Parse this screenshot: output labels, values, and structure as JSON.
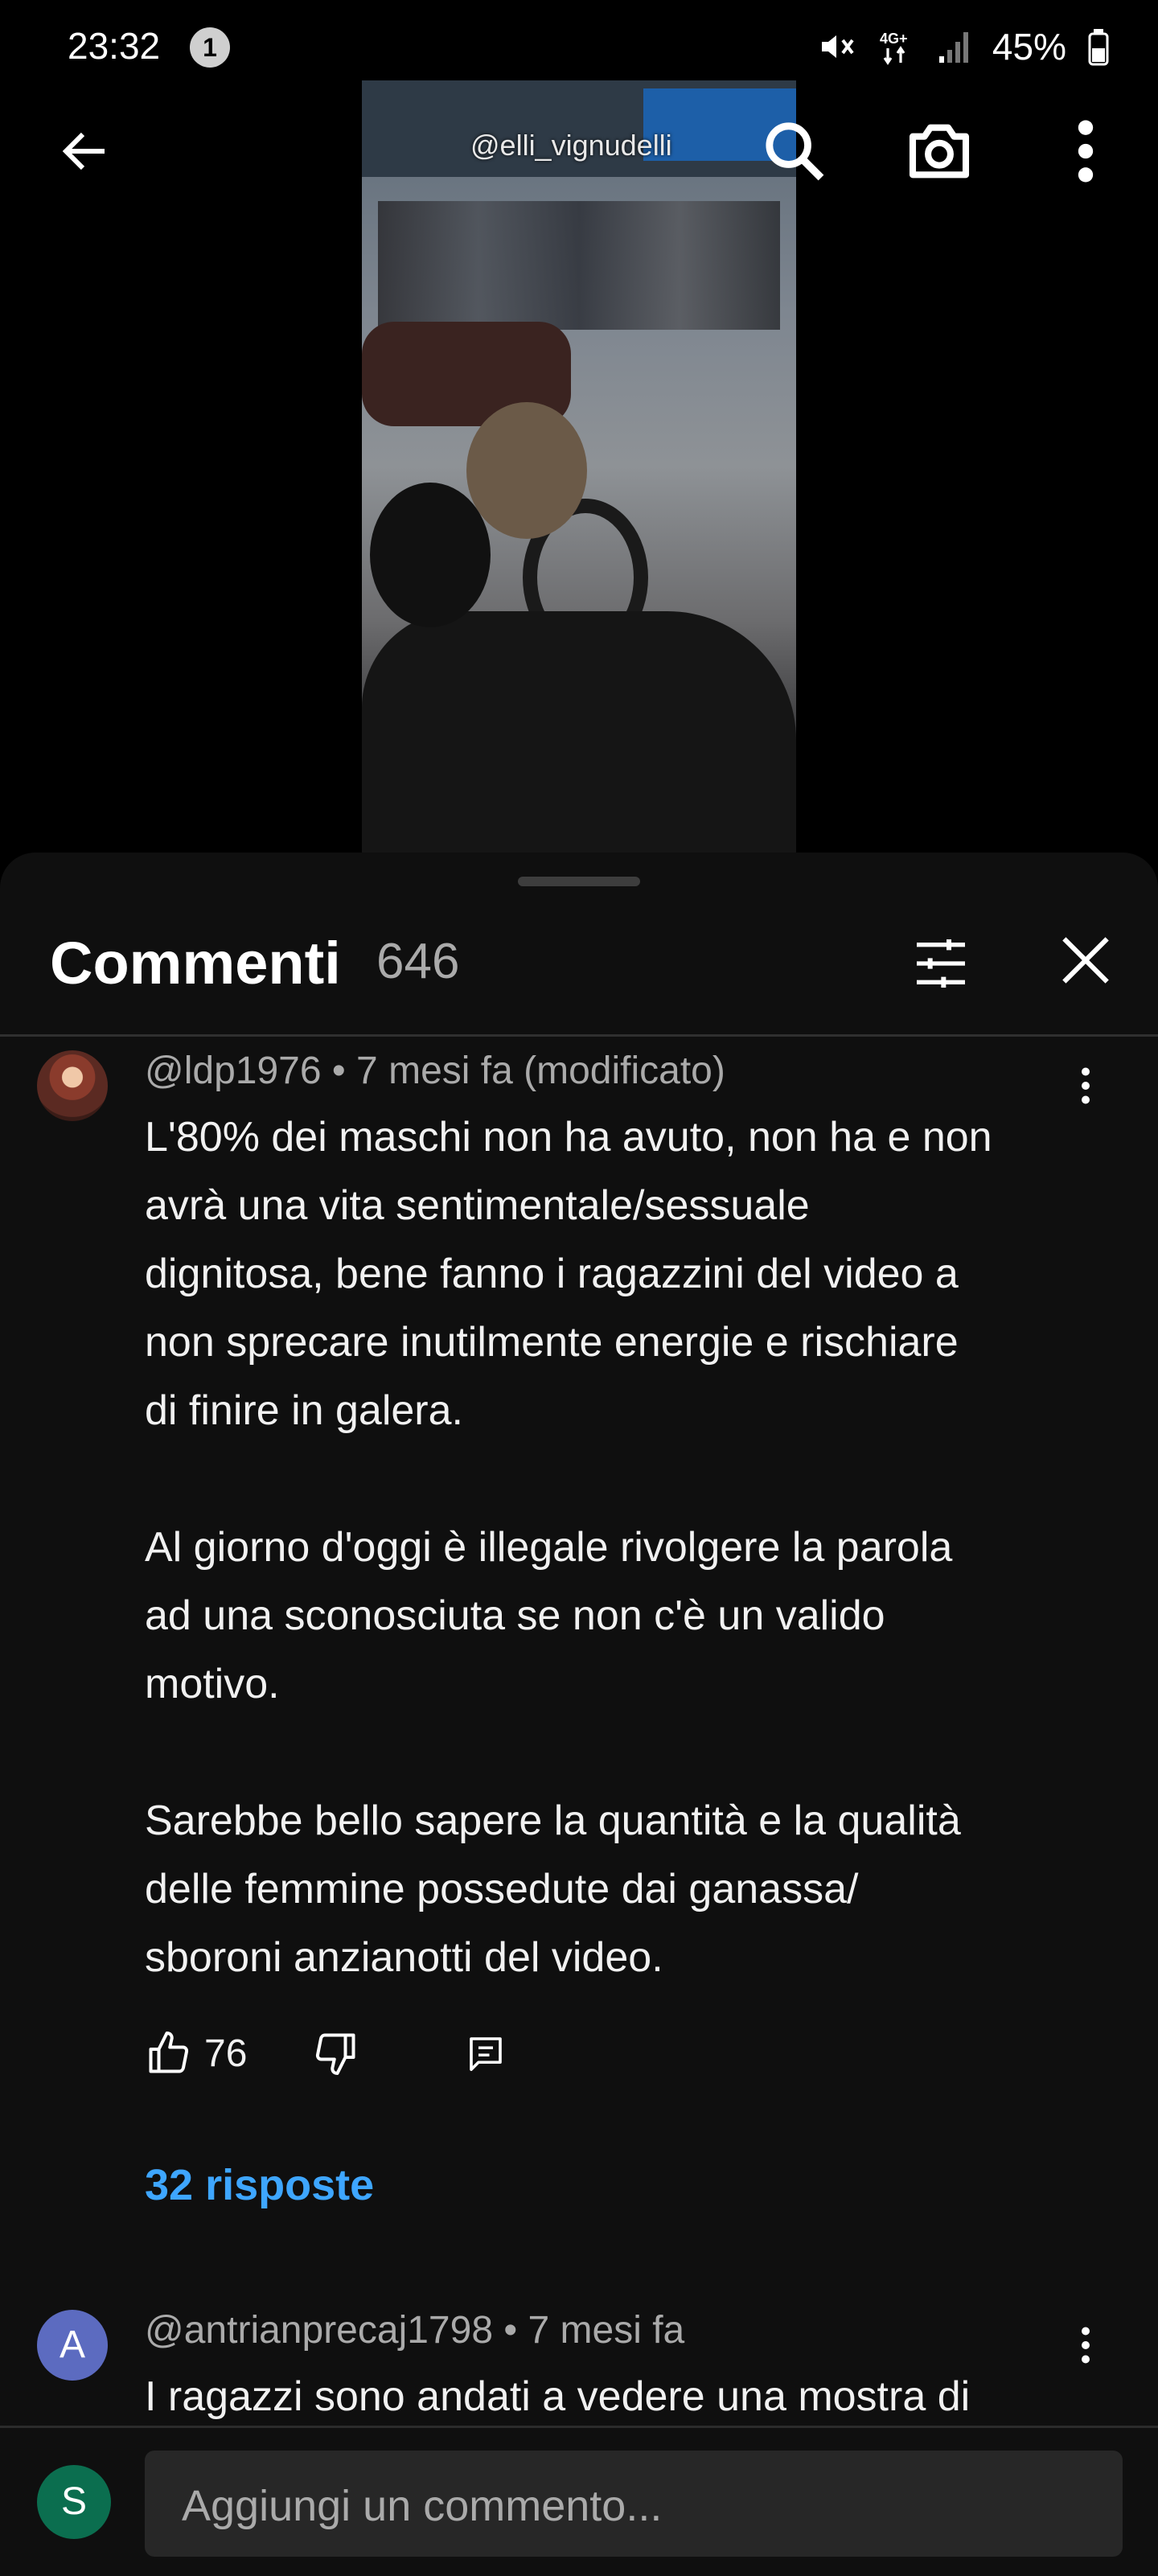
{
  "status_bar": {
    "time": "23:32",
    "notification_count": "1",
    "network": "4G+",
    "battery": "45%"
  },
  "video": {
    "watermark": "@elli_vignudelli"
  },
  "comments_sheet": {
    "title": "Commenti",
    "count": "646",
    "comments": [
      {
        "author": "@ldp1976",
        "time": "7 mesi fa (modificato)",
        "text": "L'80% dei maschi non ha avuto, non ha e non\navrà una vita sentimentale/sessuale\ndignitosa, bene fanno i ragazzini del video a\nnon sprecare inutilmente energie e rischiare\ndi finire in galera.\n\nAl giorno d'oggi è illegale rivolgere la parola\nad una sconosciuta se non c'è un valido\nmotivo.\n\nSarebbe bello sapere la quantità e la qualità\ndelle femmine possedute dai ganassa/\nsboroni anzianotti del video.",
        "likes": "76",
        "replies": "32 risposte"
      },
      {
        "author": "@antrianprecaj1798",
        "time": "7 mesi fa",
        "avatar_letter": "A",
        "text": "I ragazzi sono andati a vedere una mostra di"
      }
    ]
  },
  "comment_input": {
    "user_initial": "S",
    "placeholder": "Aggiungi un commento..."
  },
  "colors": {
    "sheet_bg": "#0f0f0f",
    "link": "#3ea6ff",
    "meta": "#aaaaaa"
  }
}
